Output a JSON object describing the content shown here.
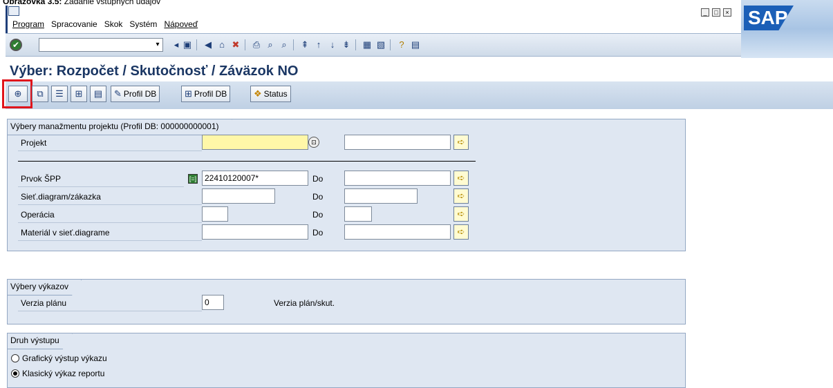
{
  "caption": {
    "bold": "Obrazovka 3.5:",
    "rest": " Zadanie vstupných údajov"
  },
  "menu": {
    "items": [
      {
        "label": "Program",
        "underline": true
      },
      {
        "label": "Spracovanie",
        "underline": false
      },
      {
        "label": "Skok",
        "underline": false
      },
      {
        "label": "Systém",
        "underline": false
      },
      {
        "label": "Nápoveď",
        "underline": true
      }
    ]
  },
  "window": {
    "minimize": "_",
    "maximize": "□",
    "close": "×"
  },
  "logo": {
    "text": "SAP"
  },
  "stdbar": {
    "okcode_value": "",
    "okcode_drop": "▾"
  },
  "title": "Výber: Rozpočet / Skutočnosť / Záväzok NO",
  "appbar": {
    "execute_icon": "⊕",
    "profile_db_1": "Profil DB",
    "profile_db_2": "Profil DB",
    "status": "Status"
  },
  "group1": {
    "title": "Výbery manažmentu projektu (Profil DB: 000000000001)",
    "projekt_label": "Projekt",
    "projekt_value": "",
    "prvok_label": "Prvok ŠPP",
    "prvok_value": "22410120007*",
    "siet_label": "Sieť.diagram/zákazka",
    "operacia_label": "Operácia",
    "material_label": "Materiál v sieť.diagrame",
    "do_label": "Do"
  },
  "group2": {
    "title": "Výbery výkazov",
    "verzia_label": "Verzia plánu",
    "verzia_value": "0",
    "verzia_desc": "Verzia plán/skut."
  },
  "group3": {
    "title": "Druh výstupu",
    "opt1": "Grafický výstup výkazu",
    "opt2": "Klasický výkaz reportu",
    "selected": "opt2"
  }
}
